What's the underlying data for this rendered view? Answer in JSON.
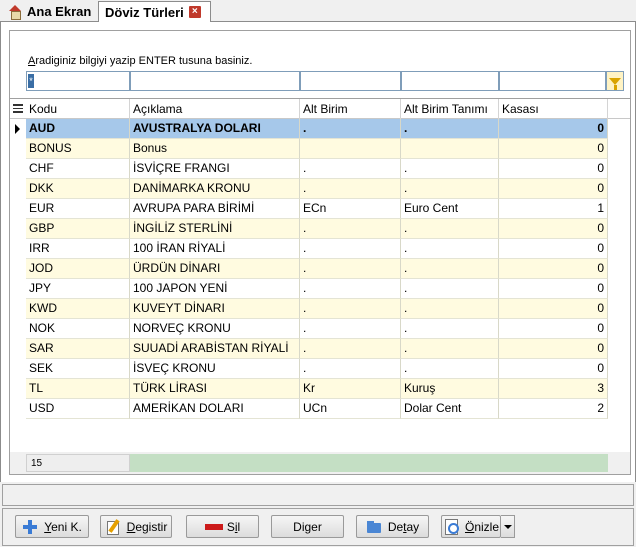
{
  "tabs": [
    {
      "label": "Ana Ekran",
      "icon": "home-icon"
    },
    {
      "label": "Döviz Türleri",
      "icon": "close-icon"
    }
  ],
  "search": {
    "hint_prefix": "A",
    "hint_rest": "radiginiz bilgiyi yazip ENTER tusuna basiniz.",
    "first_value": "*"
  },
  "grid": {
    "columns": [
      "Kodu",
      "Açıklama",
      "Alt Birim",
      "Alt Birim Tanımı",
      "Kasası"
    ],
    "rows": [
      [
        "AUD",
        "AVUSTRALYA DOLARI",
        ".",
        ".",
        "0"
      ],
      [
        "BONUS",
        "Bonus",
        "",
        "",
        "0"
      ],
      [
        "CHF",
        "İSVİÇRE FRANGI",
        ".",
        ".",
        "0"
      ],
      [
        "DKK",
        "DANİMARKA KRONU",
        ".",
        ".",
        "0"
      ],
      [
        "EUR",
        "AVRUPA PARA BİRİMİ",
        "ECn",
        "Euro Cent",
        "1"
      ],
      [
        "GBP",
        "İNGİLİZ STERLİNİ",
        ".",
        ".",
        "0"
      ],
      [
        "IRR",
        "100 İRAN RİYALİ",
        ".",
        ".",
        "0"
      ],
      [
        "JOD",
        "ÜRDÜN DİNARI",
        ".",
        ".",
        "0"
      ],
      [
        "JPY",
        "100 JAPON YENİ",
        ".",
        ".",
        "0"
      ],
      [
        "KWD",
        "KUVEYT DİNARI",
        ".",
        ".",
        "0"
      ],
      [
        "NOK",
        "NORVEÇ KRONU",
        ".",
        ".",
        "0"
      ],
      [
        "SAR",
        "SUUADİ ARABİSTAN RİYALİ",
        ".",
        ".",
        "0"
      ],
      [
        "SEK",
        "İSVEÇ KRONU",
        ".",
        ".",
        "0"
      ],
      [
        "TL",
        "TÜRK LİRASI",
        "Kr",
        "Kuruş",
        "3"
      ],
      [
        "USD",
        "AMERİKAN DOLARI",
        "UCn",
        "Dolar Cent",
        "2"
      ]
    ],
    "selected_row": 0,
    "record_count": "15"
  },
  "toolbar": {
    "new_prefix": "Y",
    "new_rest": "eni K.",
    "edit_prefix": "D",
    "edit_rest": "egistir",
    "delete_prefix": "S",
    "delete_mid": "i",
    "delete_rest": "l",
    "other": "Diger",
    "detail_pre": "De",
    "detail_u": "t",
    "detail_rest": "ay",
    "preview_prefix": "Ö",
    "preview_rest": "nizle"
  }
}
